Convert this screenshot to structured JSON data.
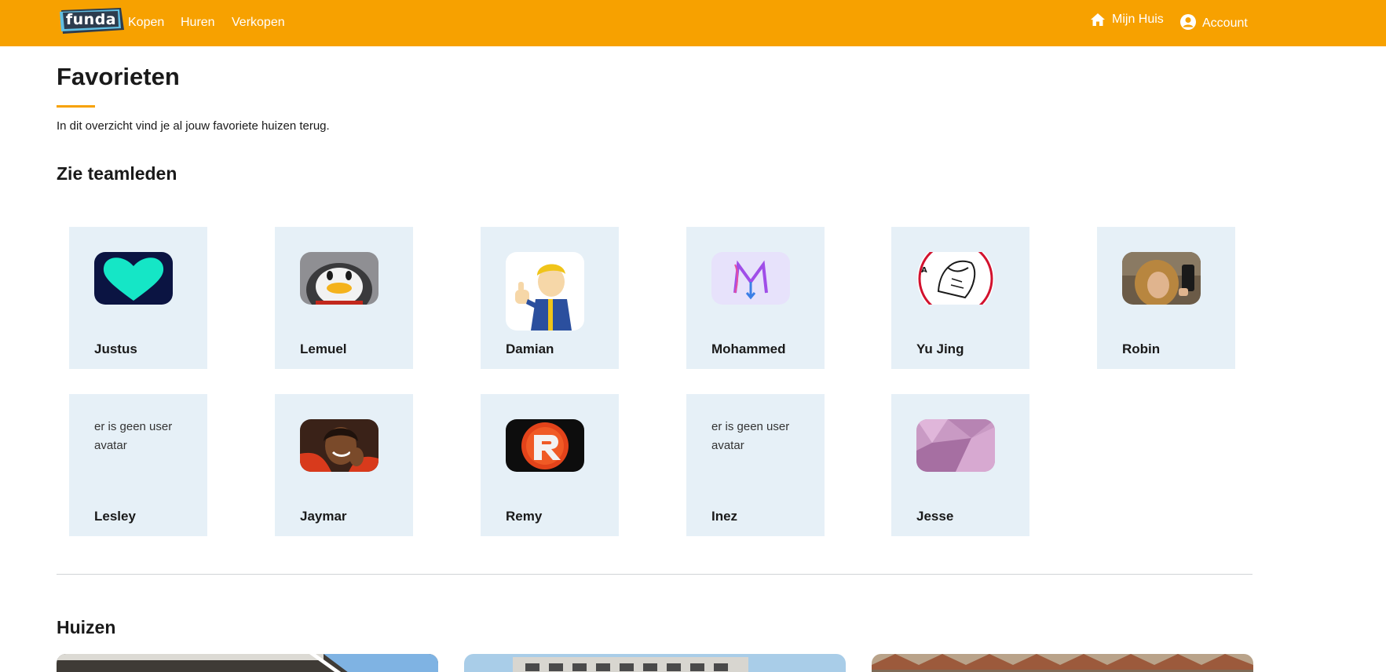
{
  "header": {
    "logo_text": "funda",
    "nav": [
      "Kopen",
      "Huren",
      "Verkopen"
    ],
    "my_house_label": "Mijn Huis",
    "account_label": "Account",
    "brand_color": "#f7a100"
  },
  "page": {
    "title": "Favorieten",
    "intro": "In dit overzicht vind je al jouw favoriete huizen terug."
  },
  "team": {
    "heading": "Zie teamleden",
    "members": [
      {
        "name": "Justus",
        "avatar": "heart-avatar"
      },
      {
        "name": "Lemuel",
        "avatar": "penguin-avatar"
      },
      {
        "name": "Damian",
        "avatar": "vault-boy-avatar"
      },
      {
        "name": "Mohammed",
        "avatar": "m-logo-avatar"
      },
      {
        "name": "Yu Jing",
        "avatar": "ajax-logo-avatar"
      },
      {
        "name": "Robin",
        "avatar": "selfie-photo-avatar"
      },
      {
        "name": "Lesley",
        "avatar": null,
        "no_avatar_text": "er is geen user avatar"
      },
      {
        "name": "Jaymar",
        "avatar": "portrait-photo-avatar"
      },
      {
        "name": "Remy",
        "avatar": "r-logo-avatar"
      },
      {
        "name": "Inez",
        "avatar": null,
        "no_avatar_text": "er is geen user avatar"
      },
      {
        "name": "Jesse",
        "avatar": "pink-crystal-avatar"
      }
    ]
  },
  "houses": {
    "heading": "Huizen",
    "items": [
      "house-photo-1",
      "house-photo-2",
      "house-photo-3"
    ]
  }
}
